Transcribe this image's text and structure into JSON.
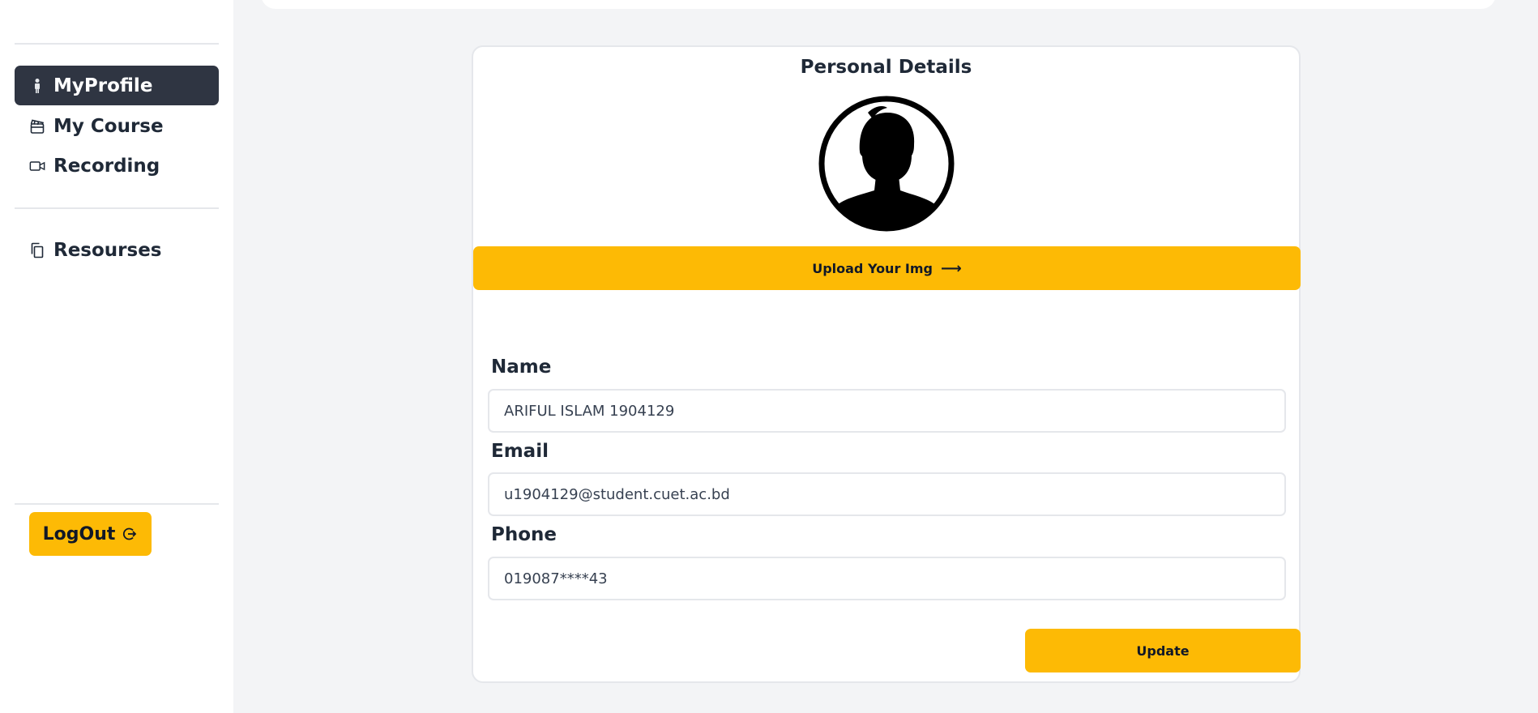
{
  "sidebar": {
    "items": [
      {
        "label": "MyProfile",
        "icon": "person-icon",
        "active": true
      },
      {
        "label": "My Course",
        "icon": "clapperboard-icon",
        "active": false
      },
      {
        "label": "Recording",
        "icon": "video-camera-icon",
        "active": false
      },
      {
        "label": "Resourses",
        "icon": "copy-documents-icon",
        "active": false
      }
    ],
    "logout_label": "LogOut",
    "logout_icon": "logout-icon"
  },
  "profile": {
    "title": "Personal Details",
    "avatar_icon": "user-silhouette-icon",
    "upload_label": "Upload Your Img",
    "upload_arrow": "⟶",
    "fields": [
      {
        "label": "Name",
        "value": "ARIFUL ISLAM 1904129"
      },
      {
        "label": "Email",
        "value": "u1904129@student.cuet.ac.bd"
      },
      {
        "label": "Phone",
        "value": "019087****43"
      }
    ],
    "update_label": "Update"
  },
  "colors": {
    "accent": "#fdba05",
    "active_nav": "#2f3542",
    "background": "#f3f4f6"
  }
}
